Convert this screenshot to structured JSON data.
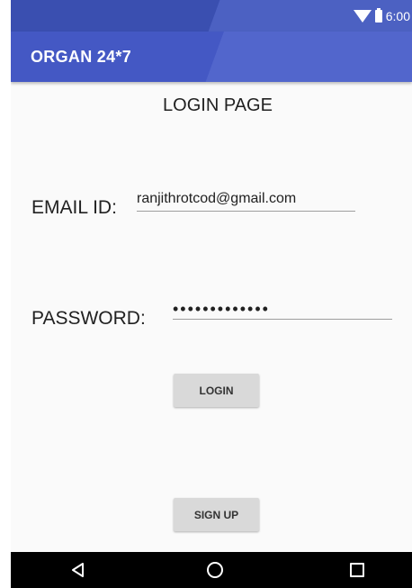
{
  "status_bar": {
    "time": "6:00",
    "icons": [
      "wifi-icon",
      "battery-icon"
    ]
  },
  "app_bar": {
    "title": "ORGAN 24*7",
    "color": "#4458c4"
  },
  "page": {
    "title": "LOGIN PAGE"
  },
  "form": {
    "email_label": "EMAIL ID:",
    "email_value": "ranjithrotcod@gmail.com",
    "password_label": "PASSWORD:",
    "password_value": "•••••••••••••"
  },
  "buttons": {
    "login_label": "LOGIN",
    "signup_label": "SIGN UP"
  },
  "nav_bar": {
    "icons": [
      "back-icon",
      "home-icon",
      "recents-icon"
    ]
  }
}
